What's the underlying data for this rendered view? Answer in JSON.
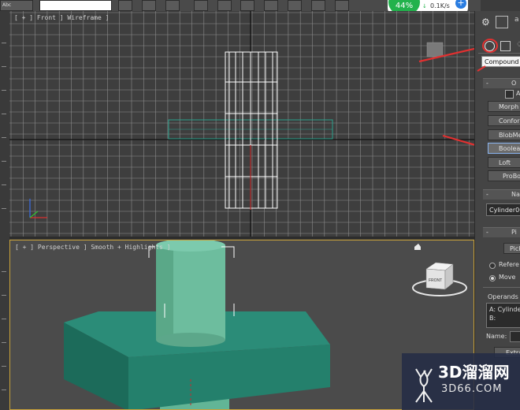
{
  "toolbar": {
    "net_percent": "44%",
    "net_speed": "0.1K/s",
    "net_plus": "+",
    "abc": "Abc"
  },
  "viewports": {
    "front_label": "[ + ] Front ] Wireframe ]",
    "persp_label": "[ + ] Perspective ] Smooth + Highlights ]",
    "viewcube_label": "FRONT"
  },
  "panel": {
    "tooltip": "Compound",
    "object_type_rollup": "O",
    "auto_grid": "A",
    "buttons": [
      "Morph",
      "Conform",
      "BlobMes",
      "Boolean",
      "Loft",
      "ProBoolea"
    ],
    "active_button_index": 3,
    "name_rollup": "Nan",
    "name_value": "Cylinder00",
    "pick_rollup": "Pi",
    "pick_button": "Pick",
    "radio_reference": "Refere",
    "radio_move": "Move",
    "operands_label": "Operands",
    "operand_a": "A: Cylinde",
    "operand_b": "B:",
    "name_label": "Name:",
    "extract_button": "Extra"
  },
  "watermark": {
    "title": "3D溜溜网",
    "url": "3D66.COM"
  },
  "colors": {
    "grid": "#8a8a8a",
    "teal_object": "#2a8a76",
    "cylinder": "#6fc0a0",
    "annotation_arrow": "#e23030"
  }
}
